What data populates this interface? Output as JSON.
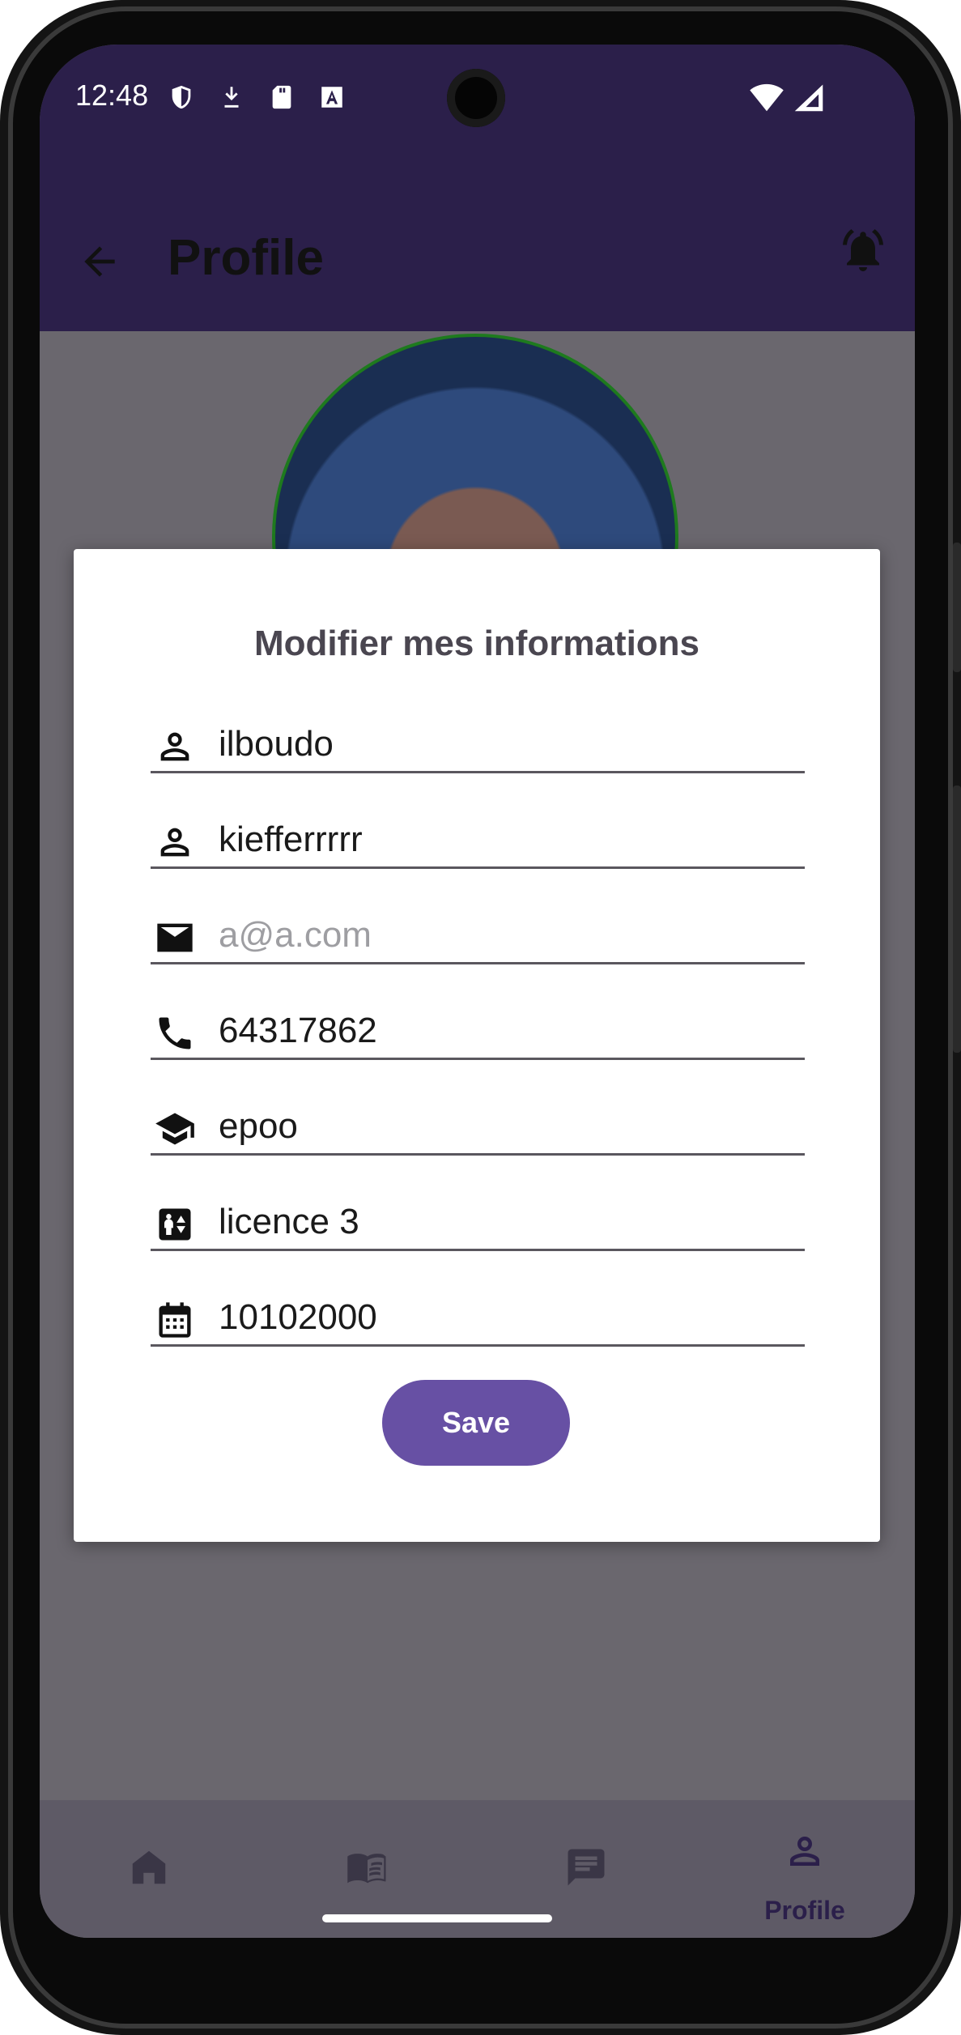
{
  "status_bar": {
    "time": "12:48"
  },
  "app_bar": {
    "title": "Profile"
  },
  "dialog": {
    "title": "Modifier mes informations",
    "fields": [
      {
        "icon": "person-icon",
        "value": "ilboudo"
      },
      {
        "icon": "person-icon",
        "value": "kiefferrrrr"
      },
      {
        "icon": "mail-icon",
        "placeholder": "a@a.com"
      },
      {
        "icon": "phone-icon",
        "value": "64317862"
      },
      {
        "icon": "school-icon",
        "value": "epoo"
      },
      {
        "icon": "level-icon",
        "value": "licence 3"
      },
      {
        "icon": "calendar-icon",
        "value": "10102000"
      }
    ],
    "save_label": "Save"
  },
  "bottom_nav": {
    "items": [
      {
        "icon": "home-icon"
      },
      {
        "icon": "book-icon"
      },
      {
        "icon": "chat-icon"
      },
      {
        "icon": "person-icon",
        "label": "Profile",
        "active": true
      }
    ]
  },
  "colors": {
    "app_bar": "#2b1f4a",
    "save_button": "#6750a4",
    "scrim": "#6a676e"
  }
}
